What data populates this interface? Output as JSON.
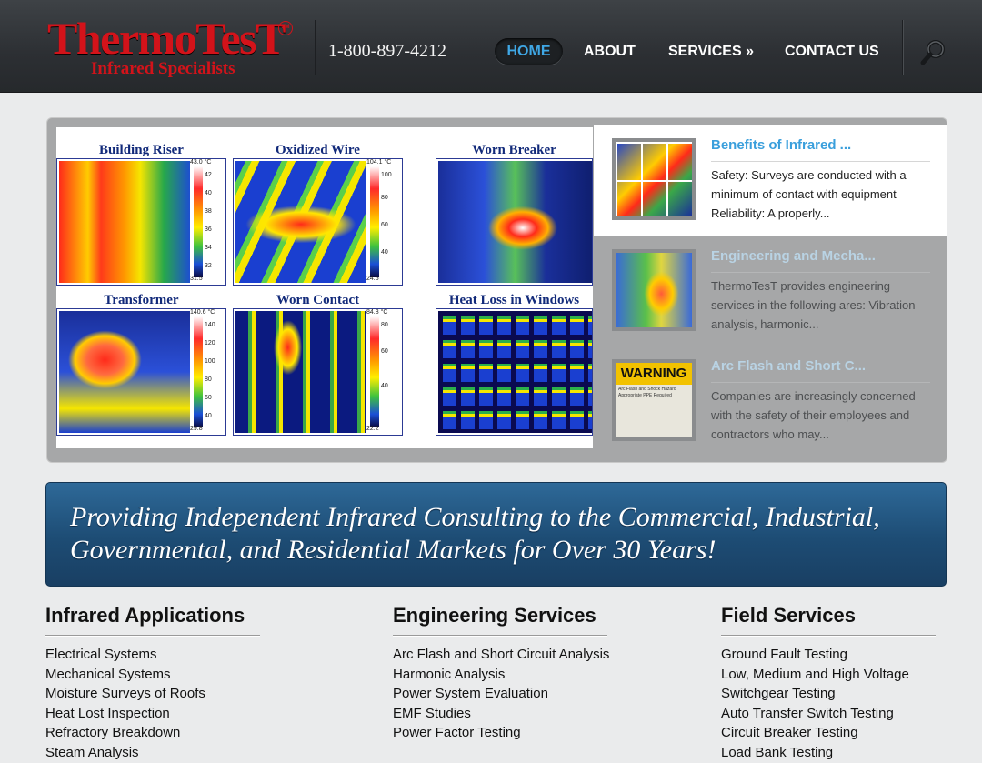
{
  "header": {
    "logo": {
      "name": "ThermoTesT",
      "mark": "SM",
      "tagline": "Infrared Specialists"
    },
    "phone": "1-800-897-4212",
    "nav": [
      "HOME",
      "ABOUT",
      "SERVICES »",
      "CONTACT US"
    ],
    "active_nav": "HOME",
    "search_icon": "search-icon"
  },
  "slider": {
    "image_cells": [
      {
        "title": "Building Riser",
        "top": "43.0 °C",
        "bottom": "31.5",
        "ticks": [
          "42",
          "40",
          "38",
          "36",
          "34",
          "32"
        ]
      },
      {
        "title": "Oxidized Wire",
        "top": "104.1 °C",
        "bottom": "24.5",
        "ticks": [
          "100",
          "80",
          "60",
          "40"
        ]
      },
      {
        "title": "Worn Breaker",
        "top": "",
        "bottom": "",
        "ticks": []
      },
      {
        "title": "Transformer",
        "top": "140.6 °C",
        "bottom": "29.8",
        "ticks": [
          "140",
          "120",
          "100",
          "80",
          "60",
          "40"
        ]
      },
      {
        "title": "Worn Contact",
        "top": "84.8 °C",
        "bottom": "22.2",
        "ticks": [
          "80",
          "60",
          "40"
        ]
      },
      {
        "title": "Heat Loss in Windows",
        "top": "",
        "bottom": "",
        "ticks": []
      }
    ],
    "items": [
      {
        "title": "Benefits of Infrared ...",
        "text": "Safety: Surveys are conducted with a minimum of contact with equipment Reliability: A properly...",
        "active": true
      },
      {
        "title": "Engineering and Mecha...",
        "text": "ThermoTesT provides engineering services in the following ares: Vibration analysis, harmonic...",
        "active": false
      },
      {
        "title": "Arc Flash and Short C...",
        "text": "Companies are increasingly concerned with the safety of their employees and contractors who may...",
        "active": false
      }
    ],
    "warning_thumb": {
      "label": "WARNING",
      "sub": "Arc Flash and Shock Hazard Appropriate PPE Required"
    }
  },
  "banner": {
    "text": "Providing Independent Infrared Consulting to the Commercial, Industrial, Governmental, and Residential Markets for Over 30 Years!"
  },
  "columns": [
    {
      "heading": "Infrared Applications",
      "items": [
        "Electrical Systems",
        "Mechanical Systems",
        "Moisture Surveys of Roofs",
        "Heat Lost Inspection",
        "Refractory Breakdown",
        "Steam Analysis"
      ]
    },
    {
      "heading": "Engineering Services",
      "items": [
        "Arc Flash and Short Circuit Analysis",
        "Harmonic Analysis",
        "Power System Evaluation",
        "EMF Studies",
        "Power Factor Testing"
      ]
    },
    {
      "heading": "Field Services",
      "items": [
        "Ground Fault Testing",
        "Low, Medium and High Voltage",
        "Switchgear Testing",
        "Auto Transfer Switch Testing",
        "Circuit Breaker Testing",
        "Load Bank Testing"
      ]
    }
  ],
  "colors": {
    "brand_red": "#d3131a",
    "accent_blue": "#3a9fdc",
    "header_dark": "#2c2f33",
    "banner_blue": "#1d4c74"
  }
}
